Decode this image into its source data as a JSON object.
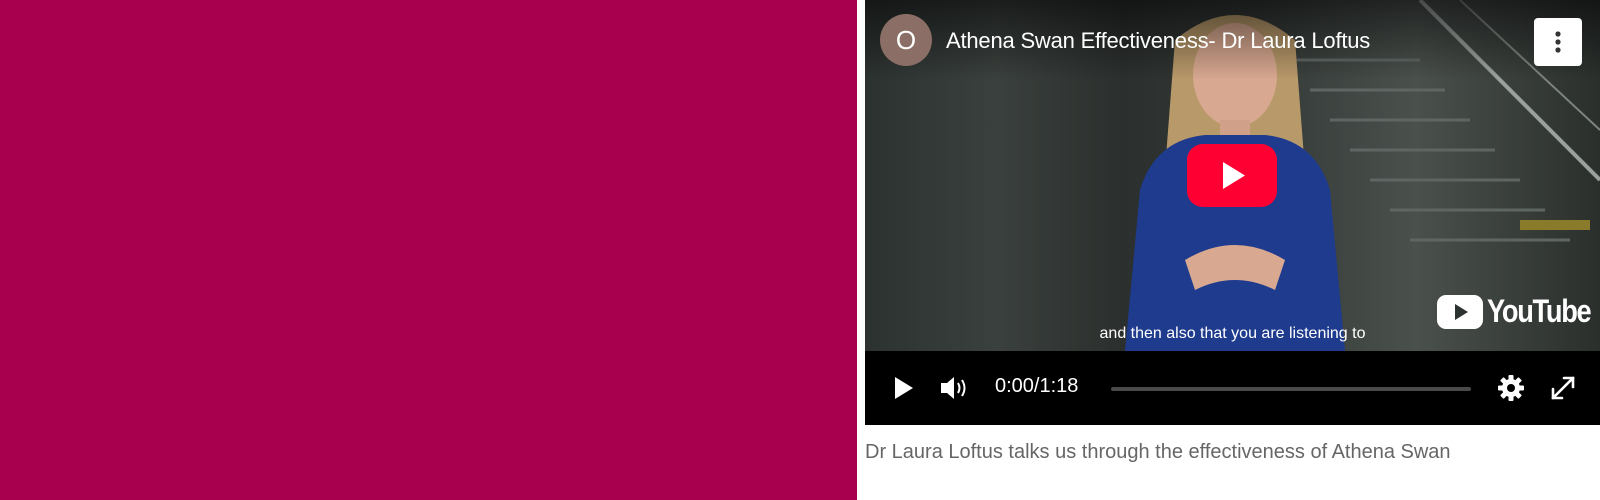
{
  "video": {
    "channel_initial": "O",
    "title": "Athena Swan Effectiveness- Dr Laura Loftus",
    "caption": "and then also that you are listening to",
    "youtube_brand": "YouTube",
    "time_display": "0:00/1:18",
    "progress": 0.0
  },
  "description": "Dr Laura Loftus talks us through the effectiveness of Athena Swan",
  "colors": {
    "brand_panel": "#a8004e",
    "youtube_red": "#ff0033"
  },
  "icons": {
    "more": "more-vertical-icon",
    "play": "play-icon",
    "volume": "volume-icon",
    "settings": "gear-icon",
    "fullscreen": "fullscreen-icon"
  }
}
